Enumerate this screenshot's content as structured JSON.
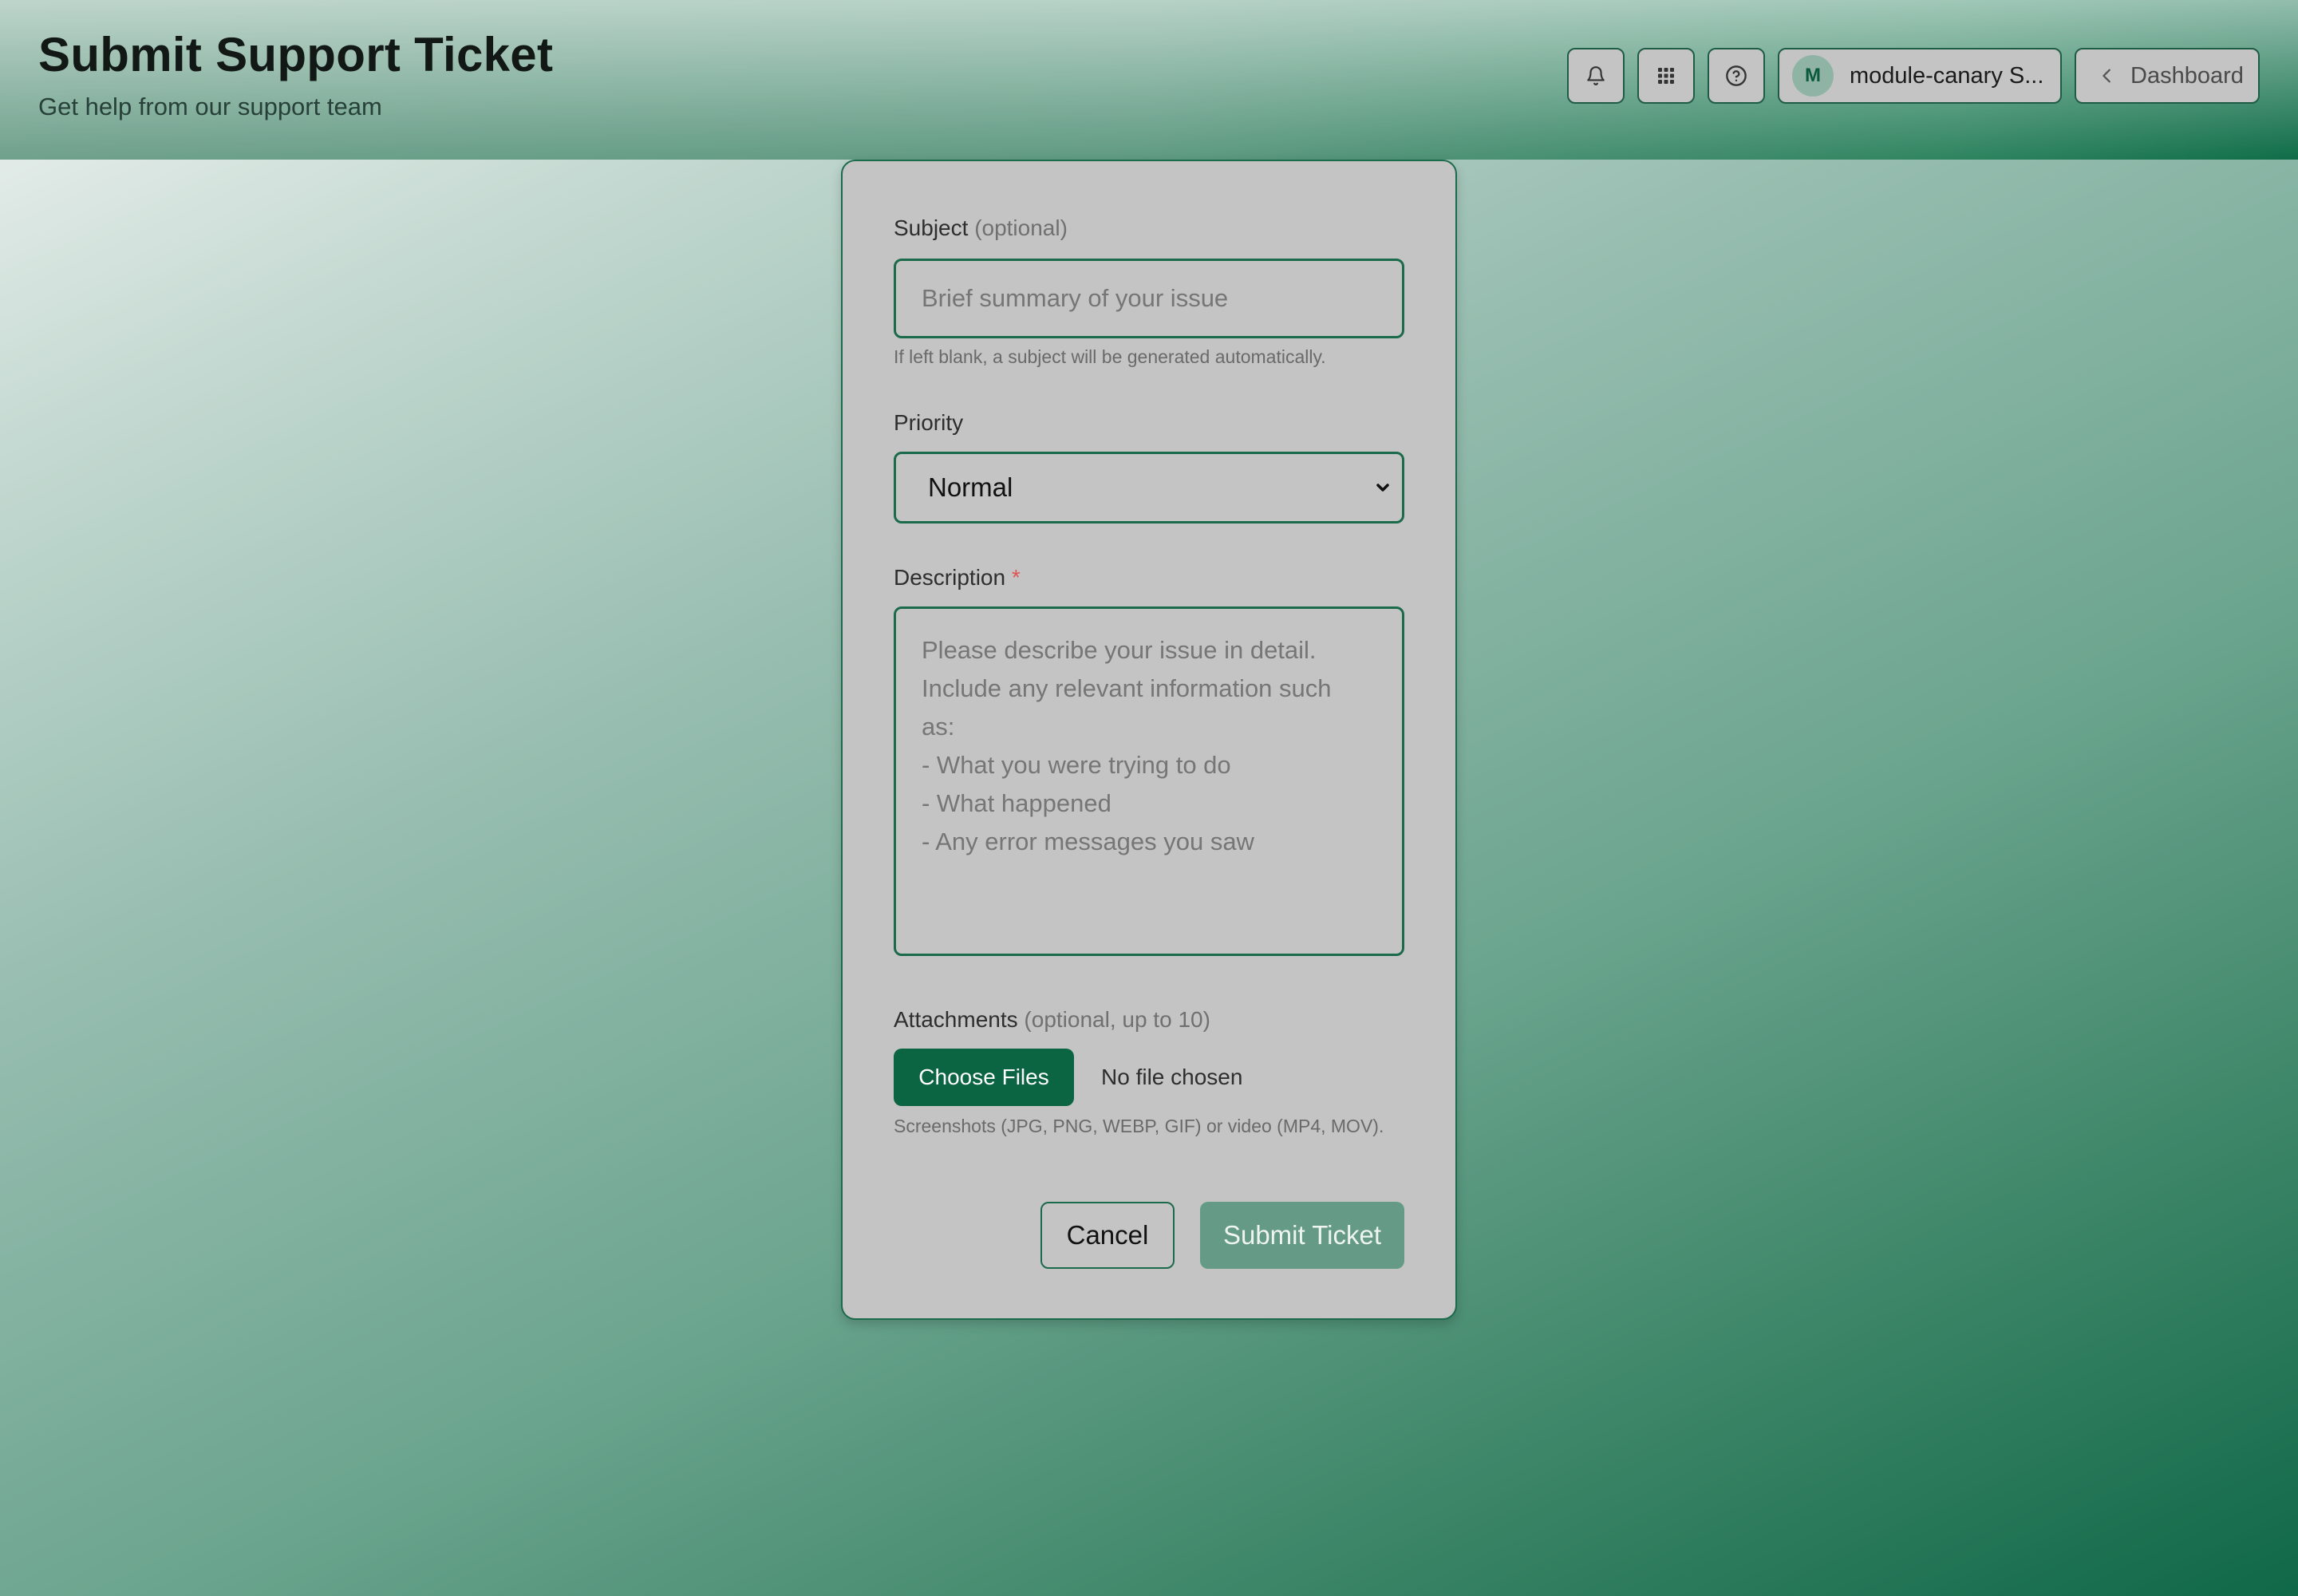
{
  "header": {
    "title": "Submit Support Ticket",
    "subtitle": "Get help from our support team",
    "user": {
      "initial": "M",
      "name": "module-canary S..."
    },
    "dashboard_label": "Dashboard",
    "icons": [
      "bell-icon",
      "grid-icon",
      "help-circle-icon",
      "chevron-left-icon"
    ]
  },
  "form": {
    "subject": {
      "label": "Subject",
      "label_suffix": "(optional)",
      "placeholder": "Brief summary of your issue",
      "value": "",
      "hint": "If left blank, a subject will be generated automatically."
    },
    "priority": {
      "label": "Priority",
      "value": "Normal"
    },
    "description": {
      "label": "Description",
      "required_marker": "*",
      "placeholder": "Please describe your issue in detail.\nInclude any relevant information such\nas:\n- What you were trying to do\n- What happened\n- Any error messages you saw"
    },
    "attachments": {
      "label": "Attachments",
      "label_suffix": "(optional, up to 10)",
      "button_label": "Choose Files",
      "status": "No file chosen",
      "hint": "Screenshots (JPG, PNG, WEBP, GIF) or video (MP4, MOV)."
    },
    "actions": {
      "cancel_label": "Cancel",
      "submit_label": "Submit Ticket"
    }
  },
  "colors": {
    "accent": "#0b6542",
    "border": "#1c6a4c",
    "card_bg": "#c4c4c4",
    "required": "#e05454",
    "submit_disabled": "#659a86"
  }
}
